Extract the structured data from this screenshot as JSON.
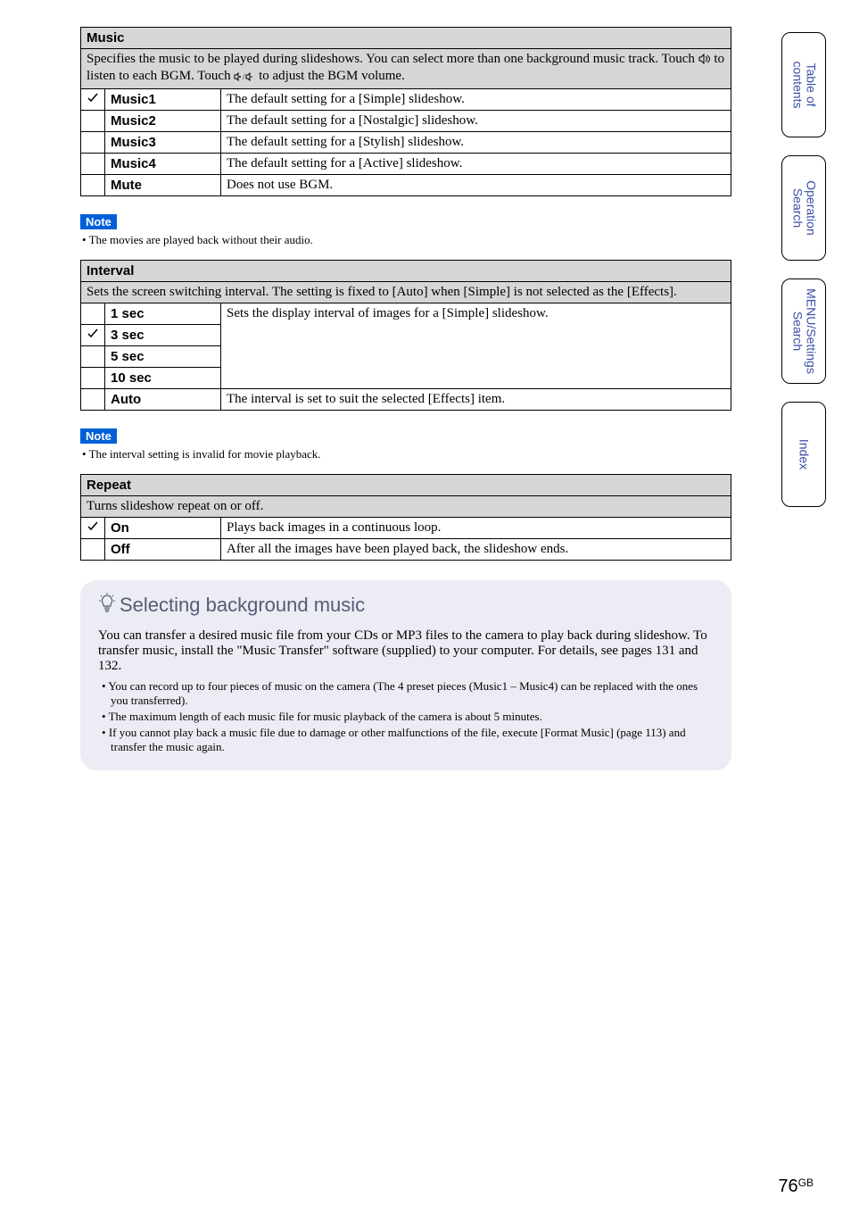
{
  "music": {
    "header": "Music",
    "description_a": "Specifies the music to be played during slideshows. You can select more than one background music track. Touch ",
    "description_b": " to listen to each BGM. Touch ",
    "description_c": " to adjust the BGM volume.",
    "rows": [
      {
        "checked": true,
        "label": "Music1",
        "desc": "The default setting for a [Simple] slideshow."
      },
      {
        "checked": false,
        "label": "Music2",
        "desc": "The default setting for a [Nostalgic] slideshow."
      },
      {
        "checked": false,
        "label": "Music3",
        "desc": "The default setting for a [Stylish] slideshow."
      },
      {
        "checked": false,
        "label": "Music4",
        "desc": "The default setting for a [Active] slideshow."
      },
      {
        "checked": false,
        "label": "Mute",
        "desc": "Does not use BGM."
      }
    ]
  },
  "note1": {
    "label": "Note",
    "text": "The movies are played back without their audio."
  },
  "interval": {
    "header": "Interval",
    "description": "Sets the screen switching interval. The setting is fixed to [Auto] when [Simple] is not selected as the [Effects].",
    "rows": [
      {
        "checked": false,
        "label": "1 sec"
      },
      {
        "checked": true,
        "label": "3 sec"
      },
      {
        "checked": false,
        "label": "5 sec"
      },
      {
        "checked": false,
        "label": "10 sec"
      }
    ],
    "shared_desc": "Sets the display interval of images for a [Simple] slideshow.",
    "auto_label": "Auto",
    "auto_desc": "The interval is set to suit the selected [Effects] item."
  },
  "note2": {
    "label": "Note",
    "text": "The interval setting is invalid for movie playback."
  },
  "repeat": {
    "header": "Repeat",
    "description": "Turns slideshow repeat on or off.",
    "rows": [
      {
        "checked": true,
        "label": "On",
        "desc": "Plays back images in a continuous loop."
      },
      {
        "checked": false,
        "label": "Off",
        "desc": "After all the images have been played back, the slideshow ends."
      }
    ]
  },
  "tip": {
    "title": "Selecting background music",
    "body": "You can transfer a desired music file from your CDs or MP3 files to the camera to play back during slideshow. To transfer music, install the \"Music Transfer\" software (supplied) to your computer. For details, see pages 131 and 132.",
    "bullets": [
      "You can record up to four pieces of music on the camera (The 4 preset pieces (Music1 – Music4) can be replaced with the ones you transferred).",
      "The maximum length of each music file for music playback of the camera is about 5 minutes.",
      "If you cannot play back a music file due to damage or other malfunctions of the file, execute [Format Music] (page 113) and transfer the music again."
    ]
  },
  "sidetabs": [
    "Table of\ncontents",
    "Operation\nSearch",
    "MENU/Settings\nSearch",
    "Index"
  ],
  "page": {
    "num": "76",
    "suffix": "GB"
  }
}
